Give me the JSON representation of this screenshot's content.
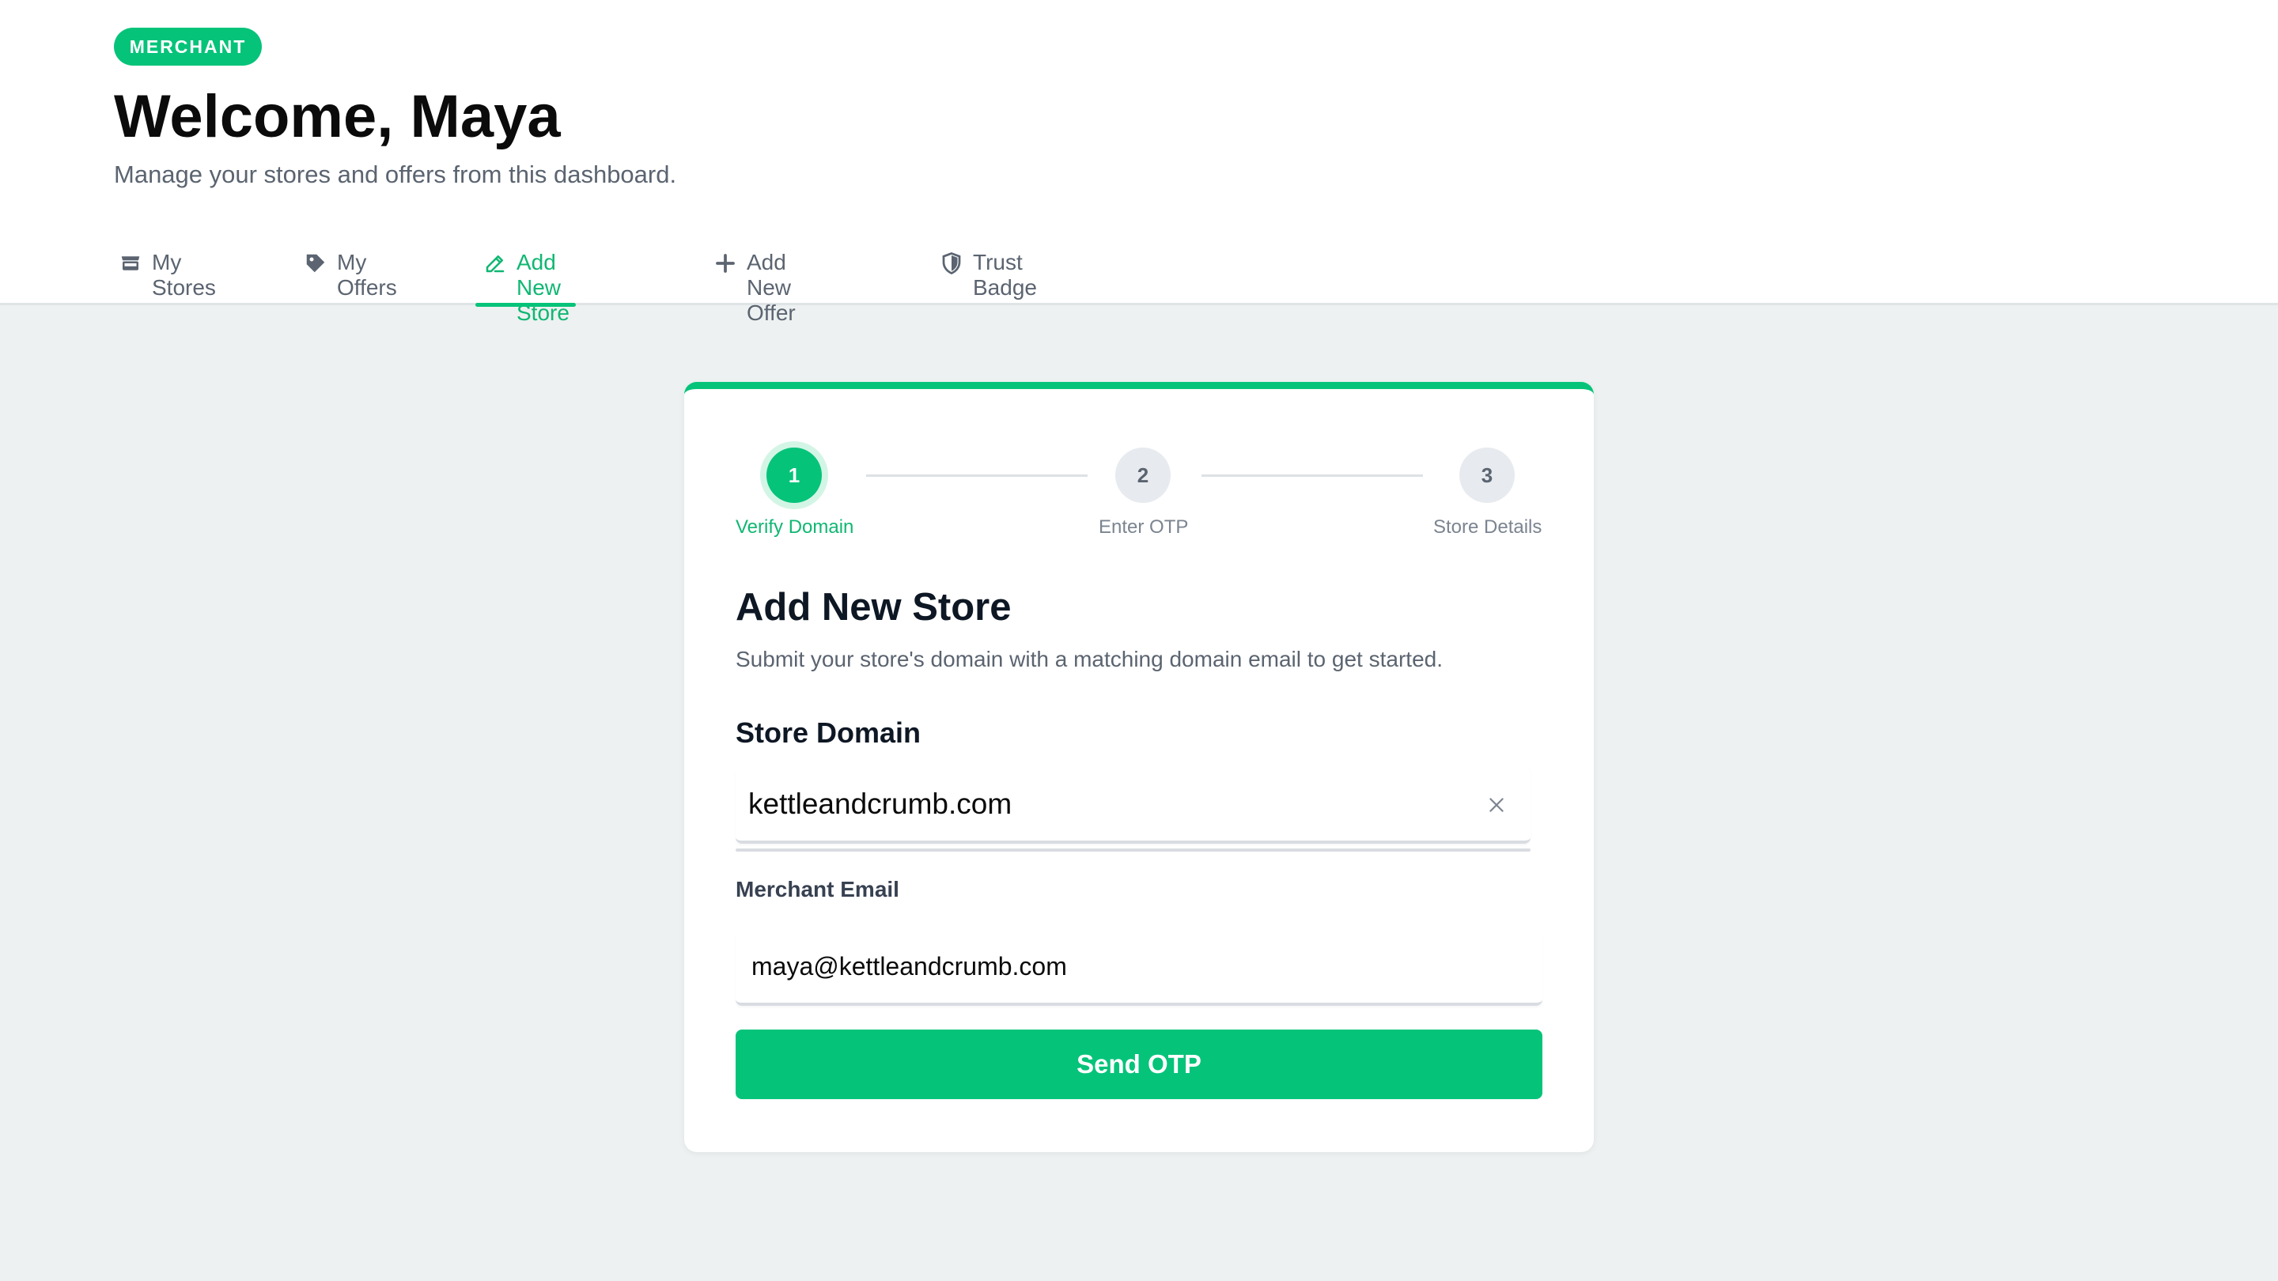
{
  "header": {
    "badge": "MERCHANT",
    "title": "Welcome, Maya",
    "subtitle": "Manage your stores and offers from this dashboard."
  },
  "tabs": [
    {
      "label": "My Stores",
      "icon": "store-icon",
      "active": false
    },
    {
      "label": "My Offers",
      "icon": "tag-icon",
      "active": false
    },
    {
      "label": "Add New Store",
      "icon": "pencil-icon",
      "active": true
    },
    {
      "label": "Add New Offer",
      "icon": "plus-icon",
      "active": false
    },
    {
      "label": "Trust Badge",
      "icon": "shield-icon",
      "active": false
    }
  ],
  "stepper": {
    "steps": [
      {
        "number": "1",
        "label": "Verify Domain",
        "state": "current"
      },
      {
        "number": "2",
        "label": "Enter OTP",
        "state": "upcoming"
      },
      {
        "number": "3",
        "label": "Store Details",
        "state": "upcoming"
      }
    ]
  },
  "form": {
    "title": "Add New Store",
    "description": "Submit your store's domain with a matching domain email to get started.",
    "domain_label": "Store Domain",
    "domain_value": "kettleandcrumb.com",
    "email_label": "Merchant Email",
    "email_value": "maya@kettleandcrumb.com",
    "submit_label": "Send OTP"
  },
  "colors": {
    "accent": "#06c37a",
    "page_bg": "#edf1f1",
    "text_dark": "#0e1724",
    "text_muted": "#5b6470"
  }
}
